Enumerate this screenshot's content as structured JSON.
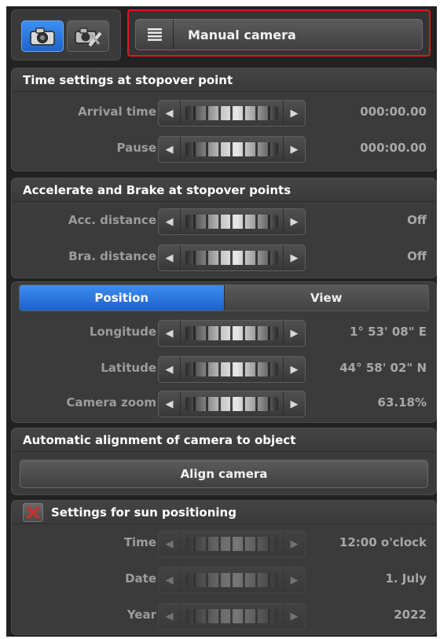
{
  "toolbar": {
    "camera_mode_icon": "camera-icon",
    "camera_edit_icon": "camera-edit-icon",
    "menu_icon": "list-menu-icon",
    "camera_select_label": "Manual camera"
  },
  "time_settings": {
    "title": "Time settings at stopover point",
    "rows": [
      {
        "label": "Arrival time",
        "value": "000:00.00"
      },
      {
        "label": "Pause",
        "value": "000:00.00"
      }
    ]
  },
  "accel": {
    "title": "Accelerate and Brake at stopover points",
    "rows": [
      {
        "label": "Acc. distance",
        "value": "Off"
      },
      {
        "label": "Bra. distance",
        "value": "Off"
      }
    ]
  },
  "tabs": {
    "position": "Position",
    "view": "View"
  },
  "position": {
    "rows": [
      {
        "label": "Longitude",
        "value": "1° 53' 08\" E"
      },
      {
        "label": "Latitude",
        "value": "44° 58' 02\" N"
      },
      {
        "label": "Camera zoom",
        "value": "63.18%"
      }
    ]
  },
  "alignment": {
    "title": "Automatic alignment of camera to object",
    "button": "Align camera"
  },
  "sun": {
    "title": "Settings for sun positioning",
    "checkbox_icon": "x-checkbox-icon",
    "rows": [
      {
        "label": "Time",
        "value": "12:00 o'clock"
      },
      {
        "label": "Date",
        "value": "1. July"
      },
      {
        "label": "Year",
        "value": "2022"
      }
    ]
  },
  "colors": {
    "accent_blue": "#2a74de",
    "highlight_red": "#e0181d",
    "panel": "#3b3b3b"
  }
}
